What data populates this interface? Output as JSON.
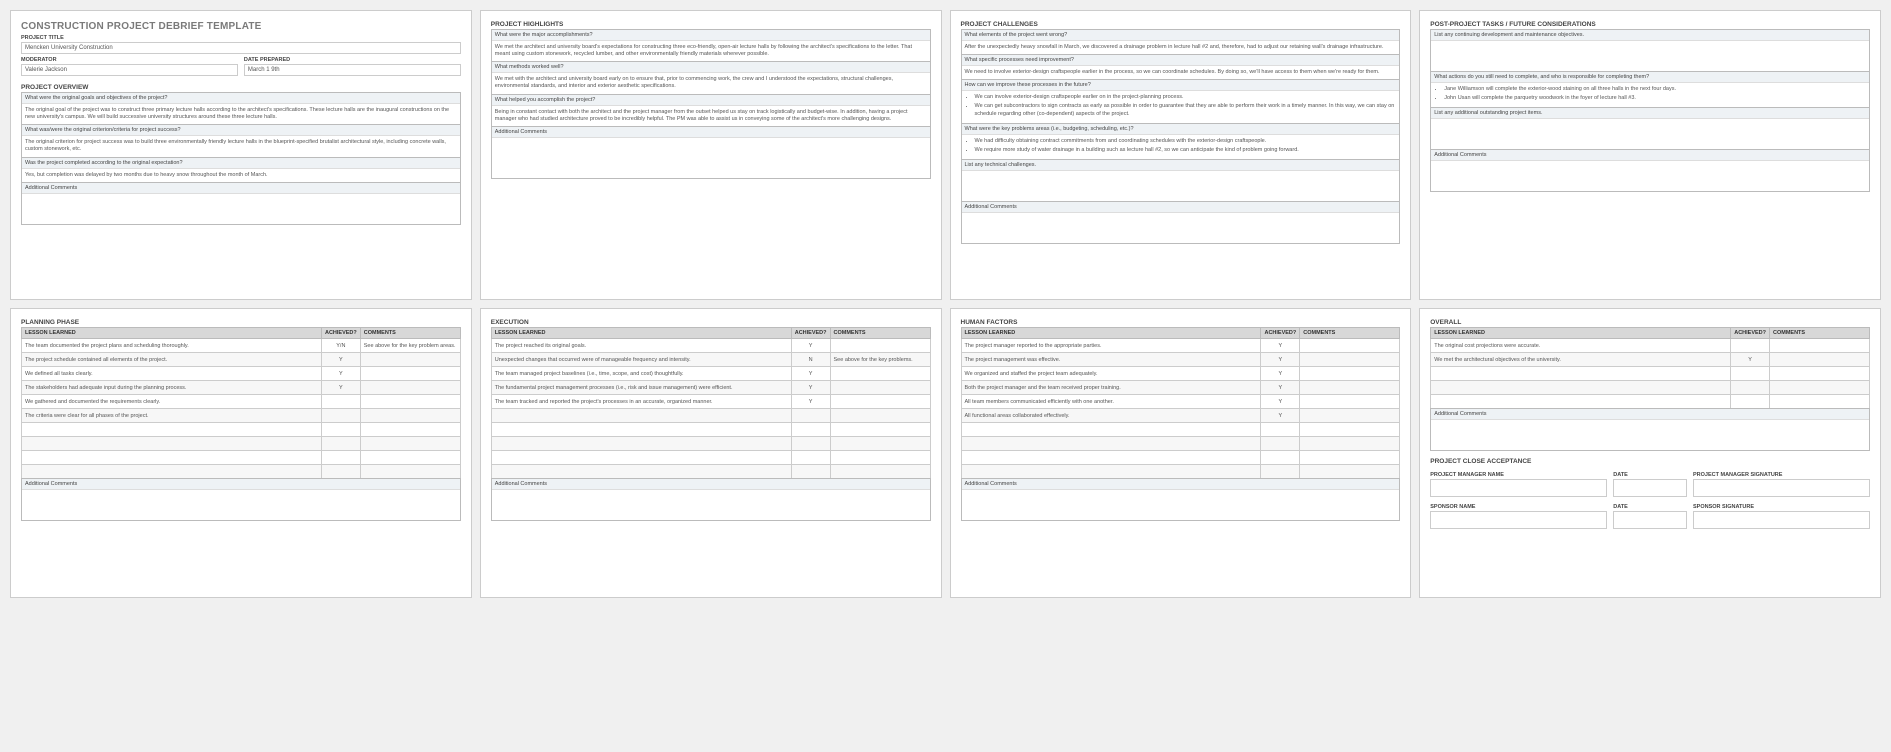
{
  "page1": {
    "title": "CONSTRUCTION PROJECT DEBRIEF TEMPLATE",
    "label_project_title": "PROJECT TITLE",
    "project_title": "Mencken University Construction",
    "label_moderator": "MODERATOR",
    "moderator": "Valerie Jackson",
    "label_date_prepared": "DATE PREPARED",
    "date_prepared": "March 1 9th",
    "section_overview": "PROJECT OVERVIEW",
    "q1": "What were the original goals and objectives of the project?",
    "a1": "The original goal of the project was to construct three primary lecture halls according to the architect's specifications. These lecture halls are the inaugural constructions on the new university's campus. We will build successive university structures around these three lecture halls.",
    "q2": "What was/were the original criterion/criteria for project success?",
    "a2": "The original criterion for project success was to build three environmentally friendly lecture halls in the blueprint-specified brutalist architectural style, including concrete walls, custom stonework, etc.",
    "q3": "Was the project completed according to the original expectation?",
    "a3": "Yes, but completion was delayed by two months due to heavy snow throughout the month of March.",
    "additional_comments": "Additional Comments"
  },
  "page2": {
    "section": "PROJECT HIGHLIGHTS",
    "q1": "What were the major accomplishments?",
    "a1": "We met the architect and university board's expectations for constructing three eco-friendly, open-air lecture halls by following the architect's specifications to the letter. That meant using custom stonework, recycled lumber, and other environmentally friendly materials wherever possible.",
    "q2": "What methods worked well?",
    "a2": "We met with the architect and university board early on to ensure that, prior to commencing work, the crew and I understood the expectations, structural challenges, environmental standards, and interior and exterior aesthetic specifications.",
    "q3": "What helped you accomplish the project?",
    "a3": "Being in constant contact with both the architect and the project manager from the outset helped us stay on track logistically and budget-wise. In addition, having a project manager who had studied architecture proved to be incredibly helpful. The PM was able to assist us in conveying some of the architect's more challenging designs.",
    "additional_comments": "Additional Comments"
  },
  "page3": {
    "section": "PROJECT CHALLENGES",
    "q1": "What elements of the project went wrong?",
    "a1": "After the unexpectedly heavy snowfall in March, we discovered a drainage problem in lecture hall #2 and, therefore, had to adjust our retaining wall's drainage infrastructure.",
    "q2": "What specific processes need improvement?",
    "a2": "We need to involve exterior-design craftspeople earlier in the process, so we can coordinate schedules. By doing so, we'll have access to them when we're ready for them.",
    "q3": "How can we improve these processes in the future?",
    "a3_items": [
      "We can involve exterior-design craftspeople earlier on in the project-planning process.",
      "We can get subcontractors to sign contracts as early as possible in order to guarantee that they are able to perform their work in a timely manner. In this way, we can stay on schedule regarding other (co-dependent) aspects of the project."
    ],
    "q4": "What were the key problems areas (i.e., budgeting, scheduling, etc.)?",
    "a4_items": [
      "We had difficulty obtaining contract commitments from and coordinating schedules with the exterior-design craftspeople.",
      "We require more study of water drainage in a building such as lecture hall #2, so we can anticipate the kind of problem going forward."
    ],
    "q5": "List any technical challenges.",
    "additional_comments": "Additional Comments"
  },
  "page4": {
    "section": "POST-PROJECT TASKS / FUTURE CONSIDERATIONS",
    "q1": "List any continuing development and maintenance objectives.",
    "q2": "What actions do you still need to complete, and who is responsible for completing them?",
    "a2_items": [
      "Jane Williamson will complete the exterior-wood staining on all three halls in the next four days.",
      "John Usan will complete the parquetry woodwork in the foyer of lecture hall #3."
    ],
    "q3": "List any additional outstanding project items.",
    "additional_comments": "Additional Comments"
  },
  "page5": {
    "section": "PLANNING PHASE",
    "th_lesson": "LESSON LEARNED",
    "th_achieved": "ACHIEVED?",
    "th_comments": "COMMENTS",
    "rows": [
      {
        "lesson": "The team documented the project plans and scheduling thoroughly.",
        "ach": "Y/N",
        "comm": "See above for the key problem areas."
      },
      {
        "lesson": "The project schedule contained all elements of the project.",
        "ach": "Y",
        "comm": ""
      },
      {
        "lesson": "We defined all tasks clearly.",
        "ach": "Y",
        "comm": ""
      },
      {
        "lesson": "The stakeholders had adequate input during the planning process.",
        "ach": "Y",
        "comm": ""
      },
      {
        "lesson": "We gathered and documented the requirements clearly.",
        "ach": "",
        "comm": ""
      },
      {
        "lesson": "The criteria were clear for all phases of the project.",
        "ach": "",
        "comm": ""
      },
      {
        "lesson": "",
        "ach": "",
        "comm": ""
      },
      {
        "lesson": "",
        "ach": "",
        "comm": ""
      },
      {
        "lesson": "",
        "ach": "",
        "comm": ""
      },
      {
        "lesson": "",
        "ach": "",
        "comm": ""
      }
    ],
    "additional_comments": "Additional Comments"
  },
  "page6": {
    "section": "EXECUTION",
    "rows": [
      {
        "lesson": "The project reached its original goals.",
        "ach": "Y",
        "comm": ""
      },
      {
        "lesson": "Unexpected changes that occurred were of manageable frequency and intensity.",
        "ach": "N",
        "comm": "See above for the key problems."
      },
      {
        "lesson": "The team managed project baselines (i.e., time, scope, and cost) thoughtfully.",
        "ach": "Y",
        "comm": ""
      },
      {
        "lesson": "The fundamental project management processes (i.e., risk and issue management) were efficient.",
        "ach": "Y",
        "comm": ""
      },
      {
        "lesson": "The team tracked and reported the project's processes in an accurate, organized manner.",
        "ach": "Y",
        "comm": ""
      },
      {
        "lesson": "",
        "ach": "",
        "comm": ""
      },
      {
        "lesson": "",
        "ach": "",
        "comm": ""
      },
      {
        "lesson": "",
        "ach": "",
        "comm": ""
      },
      {
        "lesson": "",
        "ach": "",
        "comm": ""
      },
      {
        "lesson": "",
        "ach": "",
        "comm": ""
      }
    ],
    "additional_comments": "Additional Comments"
  },
  "page7": {
    "section": "HUMAN FACTORS",
    "rows": [
      {
        "lesson": "The project manager reported to the appropriate parties.",
        "ach": "Y",
        "comm": ""
      },
      {
        "lesson": "The project management was effective.",
        "ach": "Y",
        "comm": ""
      },
      {
        "lesson": "We organized and staffed the project team adequately.",
        "ach": "Y",
        "comm": ""
      },
      {
        "lesson": "Both the project manager and the team received proper training.",
        "ach": "Y",
        "comm": ""
      },
      {
        "lesson": "All team members communicated efficiently with one another.",
        "ach": "Y",
        "comm": ""
      },
      {
        "lesson": "All functional areas collaborated effectively.",
        "ach": "Y",
        "comm": ""
      },
      {
        "lesson": "",
        "ach": "",
        "comm": ""
      },
      {
        "lesson": "",
        "ach": "",
        "comm": ""
      },
      {
        "lesson": "",
        "ach": "",
        "comm": ""
      },
      {
        "lesson": "",
        "ach": "",
        "comm": ""
      }
    ],
    "additional_comments": "Additional Comments"
  },
  "page8": {
    "section": "OVERALL",
    "rows": [
      {
        "lesson": "The original cost projections were accurate.",
        "ach": "",
        "comm": ""
      },
      {
        "lesson": "We met the architectural objectives of the university.",
        "ach": "Y",
        "comm": ""
      },
      {
        "lesson": "",
        "ach": "",
        "comm": ""
      },
      {
        "lesson": "",
        "ach": "",
        "comm": ""
      },
      {
        "lesson": "",
        "ach": "",
        "comm": ""
      }
    ],
    "additional_comments": "Additional Comments",
    "section_close": "PROJECT CLOSE ACCEPTANCE",
    "label_pm_name": "PROJECT MANAGER NAME",
    "label_date": "DATE",
    "label_pm_sig": "PROJECT MANAGER SIGNATURE",
    "label_sponsor_name": "SPONSOR NAME",
    "label_sponsor_sig": "SPONSOR SIGNATURE"
  }
}
